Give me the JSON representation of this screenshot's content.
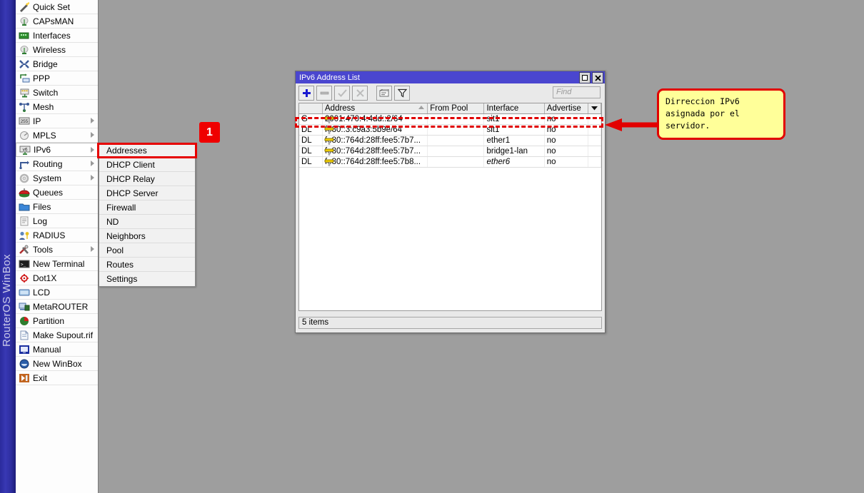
{
  "app": {
    "rail_label": "RouterOS WinBox"
  },
  "menu": {
    "items": [
      {
        "label": "Quick Set",
        "icon": "wand-icon",
        "arrow": false
      },
      {
        "label": "CAPsMAN",
        "icon": "antenna-icon",
        "arrow": false
      },
      {
        "label": "Interfaces",
        "icon": "interface-icon",
        "arrow": false
      },
      {
        "label": "Wireless",
        "icon": "antenna-icon",
        "arrow": false
      },
      {
        "label": "Bridge",
        "icon": "bridge-icon",
        "arrow": false
      },
      {
        "label": "PPP",
        "icon": "ppp-icon",
        "arrow": false
      },
      {
        "label": "Switch",
        "icon": "switch-icon",
        "arrow": false
      },
      {
        "label": "Mesh",
        "icon": "mesh-icon",
        "arrow": false
      },
      {
        "label": "IP",
        "icon": "ip-255-icon",
        "arrow": true
      },
      {
        "label": "MPLS",
        "icon": "mpls-icon",
        "arrow": true
      },
      {
        "label": "IPv6",
        "icon": "ipv6-icon",
        "arrow": true,
        "selected": true
      },
      {
        "label": "Routing",
        "icon": "routing-icon",
        "arrow": true
      },
      {
        "label": "System",
        "icon": "gear-icon",
        "arrow": true
      },
      {
        "label": "Queues",
        "icon": "queues-icon",
        "arrow": false
      },
      {
        "label": "Files",
        "icon": "folder-icon",
        "arrow": false
      },
      {
        "label": "Log",
        "icon": "log-icon",
        "arrow": false
      },
      {
        "label": "RADIUS",
        "icon": "radius-icon",
        "arrow": false
      },
      {
        "label": "Tools",
        "icon": "tools-icon",
        "arrow": true
      },
      {
        "label": "New Terminal",
        "icon": "terminal-icon",
        "arrow": false
      },
      {
        "label": "Dot1X",
        "icon": "dot1x-icon",
        "arrow": false
      },
      {
        "label": "LCD",
        "icon": "lcd-icon",
        "arrow": false
      },
      {
        "label": "MetaROUTER",
        "icon": "metarouter-icon",
        "arrow": false
      },
      {
        "label": "Partition",
        "icon": "partition-icon",
        "arrow": false
      },
      {
        "label": "Make Supout.rif",
        "icon": "document-icon",
        "arrow": false
      },
      {
        "label": "Manual",
        "icon": "manual-icon",
        "arrow": false
      },
      {
        "label": "New WinBox",
        "icon": "winbox-icon",
        "arrow": false
      },
      {
        "label": "Exit",
        "icon": "exit-icon",
        "arrow": false
      }
    ]
  },
  "submenu": {
    "parent": "IPv6",
    "items": [
      {
        "label": "Addresses",
        "highlighted": true
      },
      {
        "label": "DHCP Client"
      },
      {
        "label": "DHCP Relay"
      },
      {
        "label": "DHCP Server"
      },
      {
        "label": "Firewall"
      },
      {
        "label": "ND"
      },
      {
        "label": "Neighbors"
      },
      {
        "label": "Pool"
      },
      {
        "label": "Routes"
      },
      {
        "label": "Settings"
      }
    ]
  },
  "annotations": {
    "step_badge": "1",
    "callout_text": "Dirreccion IPv6 asignada por el servidor.",
    "highlight_color": "#e20000"
  },
  "window": {
    "title": "IPv6 Address List",
    "titlebar_buttons": [
      {
        "name": "maximize-button",
        "glyph": "□"
      },
      {
        "name": "close-button",
        "glyph": "✕"
      }
    ],
    "toolbar": [
      {
        "name": "add-button",
        "glyph": "+",
        "enabled": true
      },
      {
        "name": "remove-button",
        "glyph": "−",
        "enabled": false
      },
      {
        "name": "enable-button",
        "glyph": "✓",
        "enabled": false
      },
      {
        "name": "disable-button",
        "glyph": "✗",
        "enabled": false
      },
      {
        "name": "comment-button",
        "glyph": "☰",
        "enabled": true
      },
      {
        "name": "filter-button",
        "glyph": "∇",
        "enabled": true
      }
    ],
    "find_placeholder": "Find",
    "columns": [
      "",
      "Address",
      "From Pool",
      "Interface",
      "Advertise"
    ],
    "rows": [
      {
        "flags": "G",
        "address": "2001:470:4:4dd::2/64",
        "from_pool": "",
        "interface": "sit1",
        "interface_italic": false,
        "advertise": "no",
        "highlighted": true
      },
      {
        "flags": "DL",
        "address": "fe80::3:c9a3:5b9e/64",
        "from_pool": "",
        "interface": "sit1",
        "interface_italic": false,
        "advertise": "no"
      },
      {
        "flags": "DL",
        "address": "fe80::764d:28ff:fee5:7b7...",
        "from_pool": "",
        "interface": "ether1",
        "interface_italic": false,
        "advertise": "no"
      },
      {
        "flags": "DL",
        "address": "fe80::764d:28ff:fee5:7b7...",
        "from_pool": "",
        "interface": "bridge1-lan",
        "interface_italic": false,
        "advertise": "no"
      },
      {
        "flags": "DL",
        "address": "fe80::764d:28ff:fee5:7b8...",
        "from_pool": "",
        "interface": "ether6",
        "interface_italic": true,
        "advertise": "no"
      }
    ],
    "status": "5 items"
  }
}
